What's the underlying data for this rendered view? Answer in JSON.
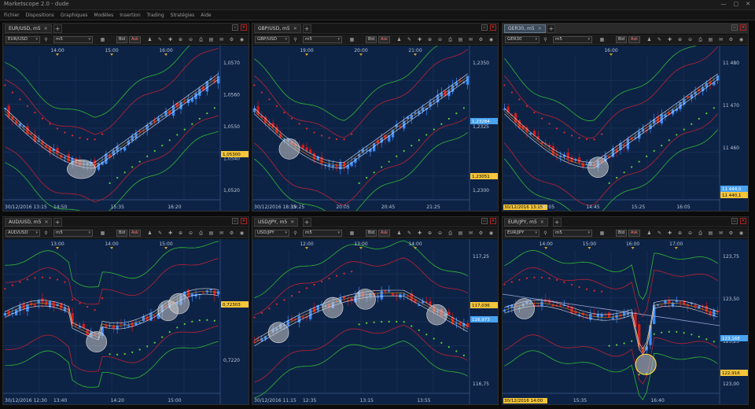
{
  "app": {
    "title": "Marketscope 2.0 - dude",
    "controls": [
      "—",
      "□",
      "✕"
    ]
  },
  "menu": [
    "Fichier",
    "Dispositions",
    "Graphiques",
    "Modèles",
    "Insertion",
    "Trading",
    "Stratégies",
    "Aide"
  ],
  "colors": {
    "up": "#3a8cff",
    "down": "#d01a1a",
    "bg": "#0d2346",
    "grid": "#1e3760",
    "green": "#2fb833",
    "red": "#bd2230",
    "sar_red": "#e02a2a",
    "sar_green": "#5ad23a",
    "price_yellow": "#f5c53a",
    "price_blue": "#49a3f2",
    "highlight": "#c8c8c8"
  },
  "panels": [
    {
      "tab": "EUR/USD, m5",
      "symbol": "EUR/USD",
      "timeframe": "m5",
      "bid": "Bid",
      "ask": "Ask",
      "active": false,
      "time_top": [
        "14:00",
        "15:00",
        "16:00"
      ],
      "time_bottom": [
        "30/12/2016 13:15",
        "14:50",
        "15:35",
        "16:20"
      ],
      "price_axis": [
        "1,0570",
        "1,0560",
        "1,0550",
        "1,0540",
        "1,0520"
      ],
      "highlights": [
        {
          "label": "1,05300",
          "kind": "yellow"
        }
      ],
      "chart_data": {
        "type": "candlestick",
        "trend": "dip-then-rally",
        "y_range": [
          1.0515,
          1.0578
        ]
      }
    },
    {
      "tab": "GBP/USD, m5",
      "symbol": "GBP/USD",
      "timeframe": "m5",
      "bid": "Bid",
      "ask": "Ask",
      "active": false,
      "time_top": [
        "19:00",
        "20:00",
        "21:00"
      ],
      "time_bottom": [
        "30/12/2016 18:35",
        "19:25",
        "20:05",
        "20:45",
        "21:25"
      ],
      "price_axis": [
        "1,2350",
        "1,2325",
        "1,2300"
      ],
      "highlights": [
        {
          "label": "1,23284",
          "kind": "blue"
        },
        {
          "label": "1,23051",
          "kind": "yellow"
        }
      ],
      "chart_data": {
        "type": "candlestick",
        "trend": "dip-then-rally",
        "y_range": [
          1.2295,
          1.236
        ]
      }
    },
    {
      "tab": "GER30, m5",
      "symbol": "GER30",
      "timeframe": "m5",
      "bid": "Bid",
      "ask": "Ask",
      "active": true,
      "time_top": [
        "16:00"
      ],
      "time_bottom": [
        "30/12/2016 13:15",
        "14:05",
        "14:45",
        "15:25",
        "16:05"
      ],
      "price_axis": [
        "11 480",
        "11 470",
        "11 460",
        "11 450"
      ],
      "highlights": [
        {
          "label": "11 444,0",
          "kind": "blue"
        },
        {
          "label": "11 440,1",
          "kind": "yellow"
        }
      ],
      "chart_data": {
        "type": "candlestick",
        "trend": "dip-then-rally",
        "y_range": [
          11438,
          11484
        ]
      }
    },
    {
      "tab": "AUD/USD, m5",
      "symbol": "AUD/USD",
      "timeframe": "m5",
      "bid": "Bid",
      "ask": "Ask",
      "active": false,
      "time_top": [
        "13:00",
        "14:00",
        "15:00"
      ],
      "time_bottom": [
        "30/12/2016 12:30",
        "13:40",
        "14:20",
        "15:00"
      ],
      "price_axis": [
        "0,7220"
      ],
      "highlights": [
        {
          "label": "0,72303",
          "kind": "yellow"
        }
      ],
      "chart_data": {
        "type": "candlestick",
        "trend": "range",
        "y_range": [
          0.7205,
          0.7245
        ]
      }
    },
    {
      "tab": "USD/JPY, m5",
      "symbol": "USD/JPY",
      "timeframe": "m5",
      "bid": "Bid",
      "ask": "Ask",
      "active": false,
      "time_top": [
        "12:00",
        "13:00",
        "14:00"
      ],
      "time_bottom": [
        "30/12/2016 11:15",
        "12:35",
        "13:15",
        "13:55"
      ],
      "price_axis": [
        "117,25",
        "116,75"
      ],
      "highlights": [
        {
          "label": "117,036",
          "kind": "yellow"
        },
        {
          "label": "116,973",
          "kind": "blue"
        }
      ],
      "chart_data": {
        "type": "candlestick",
        "trend": "rally-then-pullback",
        "y_range": [
          116.6,
          117.35
        ]
      }
    },
    {
      "tab": "EUR/JPY, m5",
      "symbol": "EUR/JPY",
      "timeframe": "m5",
      "bid": "Bid",
      "ask": "Ask",
      "active": false,
      "time_top": [
        "14:00",
        "15:00",
        "16:00",
        "17:00"
      ],
      "time_bottom": [
        "30/12/2016 14:00",
        "15:35",
        "16:40"
      ],
      "price_axis": [
        "123,75",
        "123,50",
        "123,25",
        "123,00"
      ],
      "highlights": [
        {
          "label": "123,168",
          "kind": "blue"
        },
        {
          "label": "122,916",
          "kind": "yellow"
        }
      ],
      "chart_data": {
        "type": "candlestick",
        "trend": "range-with-spike",
        "y_range": [
          122.82,
          123.82
        ]
      }
    }
  ]
}
